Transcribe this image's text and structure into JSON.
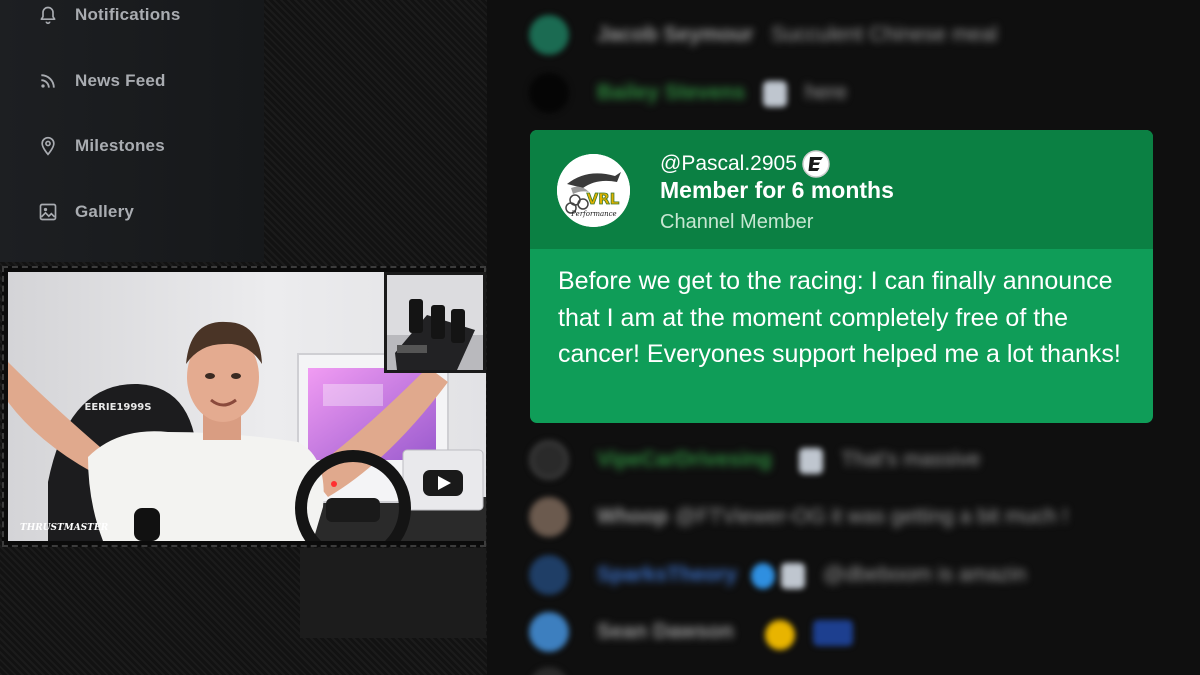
{
  "sidebar": {
    "items": [
      {
        "label": "Notifications",
        "icon": "bell-icon"
      },
      {
        "label": "News Feed",
        "icon": "rss-icon"
      },
      {
        "label": "Milestones",
        "icon": "map-pin-icon"
      },
      {
        "label": "Gallery",
        "icon": "image-icon"
      }
    ]
  },
  "stream": {
    "chair_text": "EERIE1999S",
    "brand_text": "THRUSTMASTER",
    "logo_text": "Performance",
    "logo_abbrev": "VRL"
  },
  "chat": {
    "messages_above": [
      {
        "author": "Jacob Seymour",
        "text": "Succulent Chinese meal",
        "author_color": "#9a9a9a",
        "avatar_color": "#1b6b52"
      },
      {
        "author": "Bailey Stevens",
        "text": "here",
        "author_color": "#2e8b3e",
        "avatar_color": "#0a0a0a"
      }
    ],
    "highlight": {
      "author": "@Pascal.2905",
      "membership": "Member for 6 months",
      "level": "Channel Member",
      "message": "Before we get to the racing: I can finally announce that I am at the moment completely free of the cancer! Everyones support helped me a lot thanks!",
      "header_color": "#0b8043",
      "body_color": "#0f9d58"
    },
    "messages_below": [
      {
        "author": "VipeCarDrivesing",
        "text": "That's massive",
        "author_color": "#2e8b3e",
        "avatar_color": "#2a2a2a"
      },
      {
        "author": "Whoop",
        "text": "@FTViewer-OG it was getting a bit much !",
        "author_color": "#9a9a9a",
        "avatar_color": "#6b5a4e"
      },
      {
        "author": "SparksTheory",
        "text": "@dbeboom is amazin",
        "author_color": "#3b6fc4",
        "avatar_color": "#1f3e66"
      },
      {
        "author": "Sean Dawson",
        "text": "",
        "author_color": "#9a9a9a",
        "avatar_color": "#3d7fbf"
      }
    ]
  },
  "colors": {
    "page_bg": "#0f0f0f",
    "sidebar_text": "#a9acb1",
    "highlight_header": "#0b8043",
    "highlight_body": "#0f9d58"
  }
}
